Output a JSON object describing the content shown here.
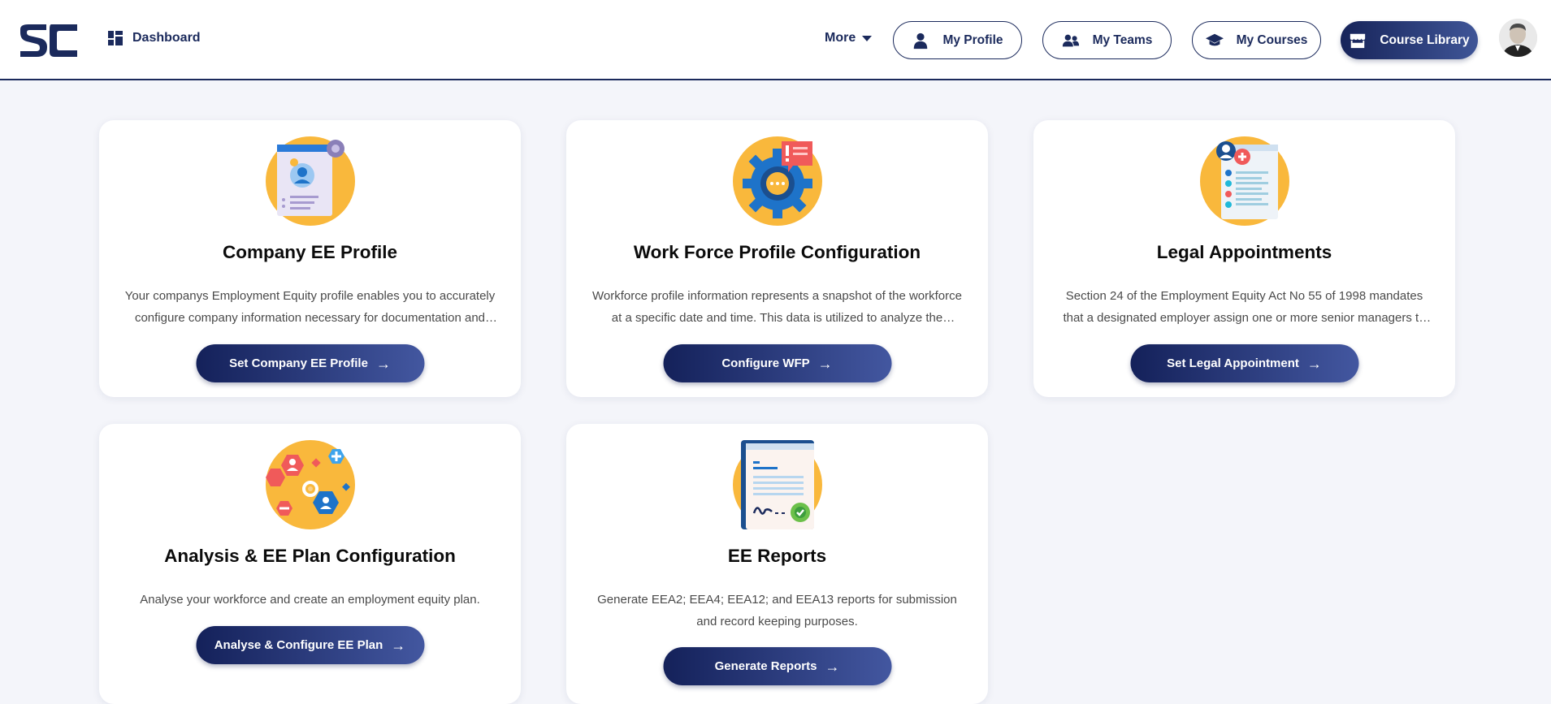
{
  "header": {
    "dashboard_label": "Dashboard",
    "more_label": "More",
    "nav": [
      {
        "label": "My Profile",
        "icon": "user-icon"
      },
      {
        "label": "My Teams",
        "icon": "users-icon"
      },
      {
        "label": "My Courses",
        "icon": "graduation-cap-icon"
      },
      {
        "label": "Course Library",
        "icon": "store-icon"
      }
    ]
  },
  "cards": [
    {
      "title": "Company EE Profile",
      "description": "Your companys Employment Equity profile enables you to accurately configure company information necessary for documentation and reporting purposes.",
      "button": "Set Company EE Profile"
    },
    {
      "title": "Work Force Profile Configuration",
      "description": "Workforce profile information represents a snapshot of the workforce at a specific date and time. This data is utilized to analyze the workforce profile.",
      "button": "Configure WFP"
    },
    {
      "title": "Legal Appointments",
      "description": "Section 24 of the Employment Equity Act No 55 of 1998 mandates that a designated employer assign one or more senior managers to oversee the implementation.",
      "button": "Set Legal Appointment"
    },
    {
      "title": "Analysis & EE Plan Configuration",
      "description": "Analyse your workforce and create an employment equity plan.",
      "button": "Analyse & Configure EE Plan"
    },
    {
      "title": "EE Reports",
      "description": "Generate EEA2; EEA4; EEA12; and EEA13 reports for submission and record keeping purposes.",
      "button": "Generate Reports"
    }
  ],
  "colors": {
    "brand_navy": "#1b2a5c",
    "button_gradient_start": "#14215a",
    "button_gradient_end": "#4357a0",
    "icon_circle_yellow": "#f9b83c"
  }
}
